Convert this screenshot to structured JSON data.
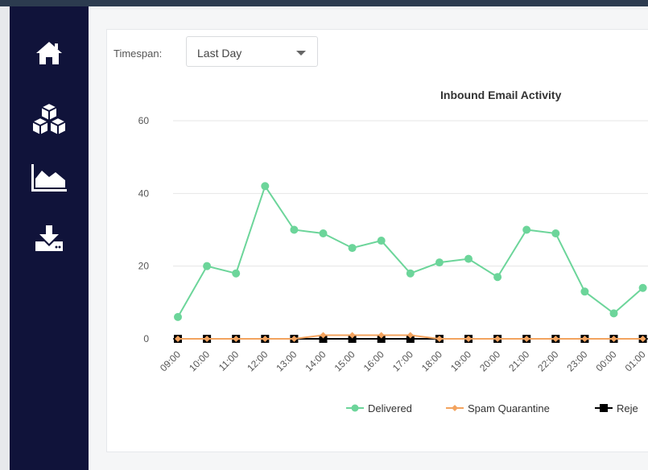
{
  "sidebar": {
    "items": [
      {
        "icon": "home-icon"
      },
      {
        "icon": "cubes-icon"
      },
      {
        "icon": "area-chart-icon"
      },
      {
        "icon": "download-icon"
      }
    ],
    "background": "#10133a"
  },
  "filter": {
    "label": "Timespan:",
    "selected": "Last Day"
  },
  "chart_data": {
    "type": "line",
    "title": "Inbound Email Activity",
    "categories": [
      "09:00",
      "10:00",
      "11:00",
      "12:00",
      "13:00",
      "14:00",
      "15:00",
      "16:00",
      "17:00",
      "18:00",
      "19:00",
      "20:00",
      "21:00",
      "22:00",
      "23:00",
      "00:00",
      "01:00"
    ],
    "ylim": [
      0,
      60
    ],
    "yticks": [
      0,
      20,
      40,
      60
    ],
    "grid": true,
    "legend_position": "bottom",
    "series": [
      {
        "name": "Delivered",
        "color": "#6cd59a",
        "marker": "circle",
        "values": [
          6,
          20,
          18,
          42,
          30,
          29,
          25,
          27,
          18,
          21,
          22,
          17,
          30,
          29,
          13,
          7,
          14
        ]
      },
      {
        "name": "Spam Quarantine",
        "color": "#f3a35e",
        "marker": "diamond",
        "values": [
          0,
          0,
          0,
          0,
          0,
          1,
          1,
          1,
          1,
          0,
          0,
          0,
          0,
          0,
          0,
          0,
          0
        ]
      },
      {
        "name": "Reje",
        "color": "#000000",
        "marker": "square",
        "values": [
          0,
          0,
          0,
          0,
          0,
          0,
          0,
          0,
          0,
          0,
          0,
          0,
          0,
          0,
          0,
          0,
          0
        ]
      }
    ]
  }
}
